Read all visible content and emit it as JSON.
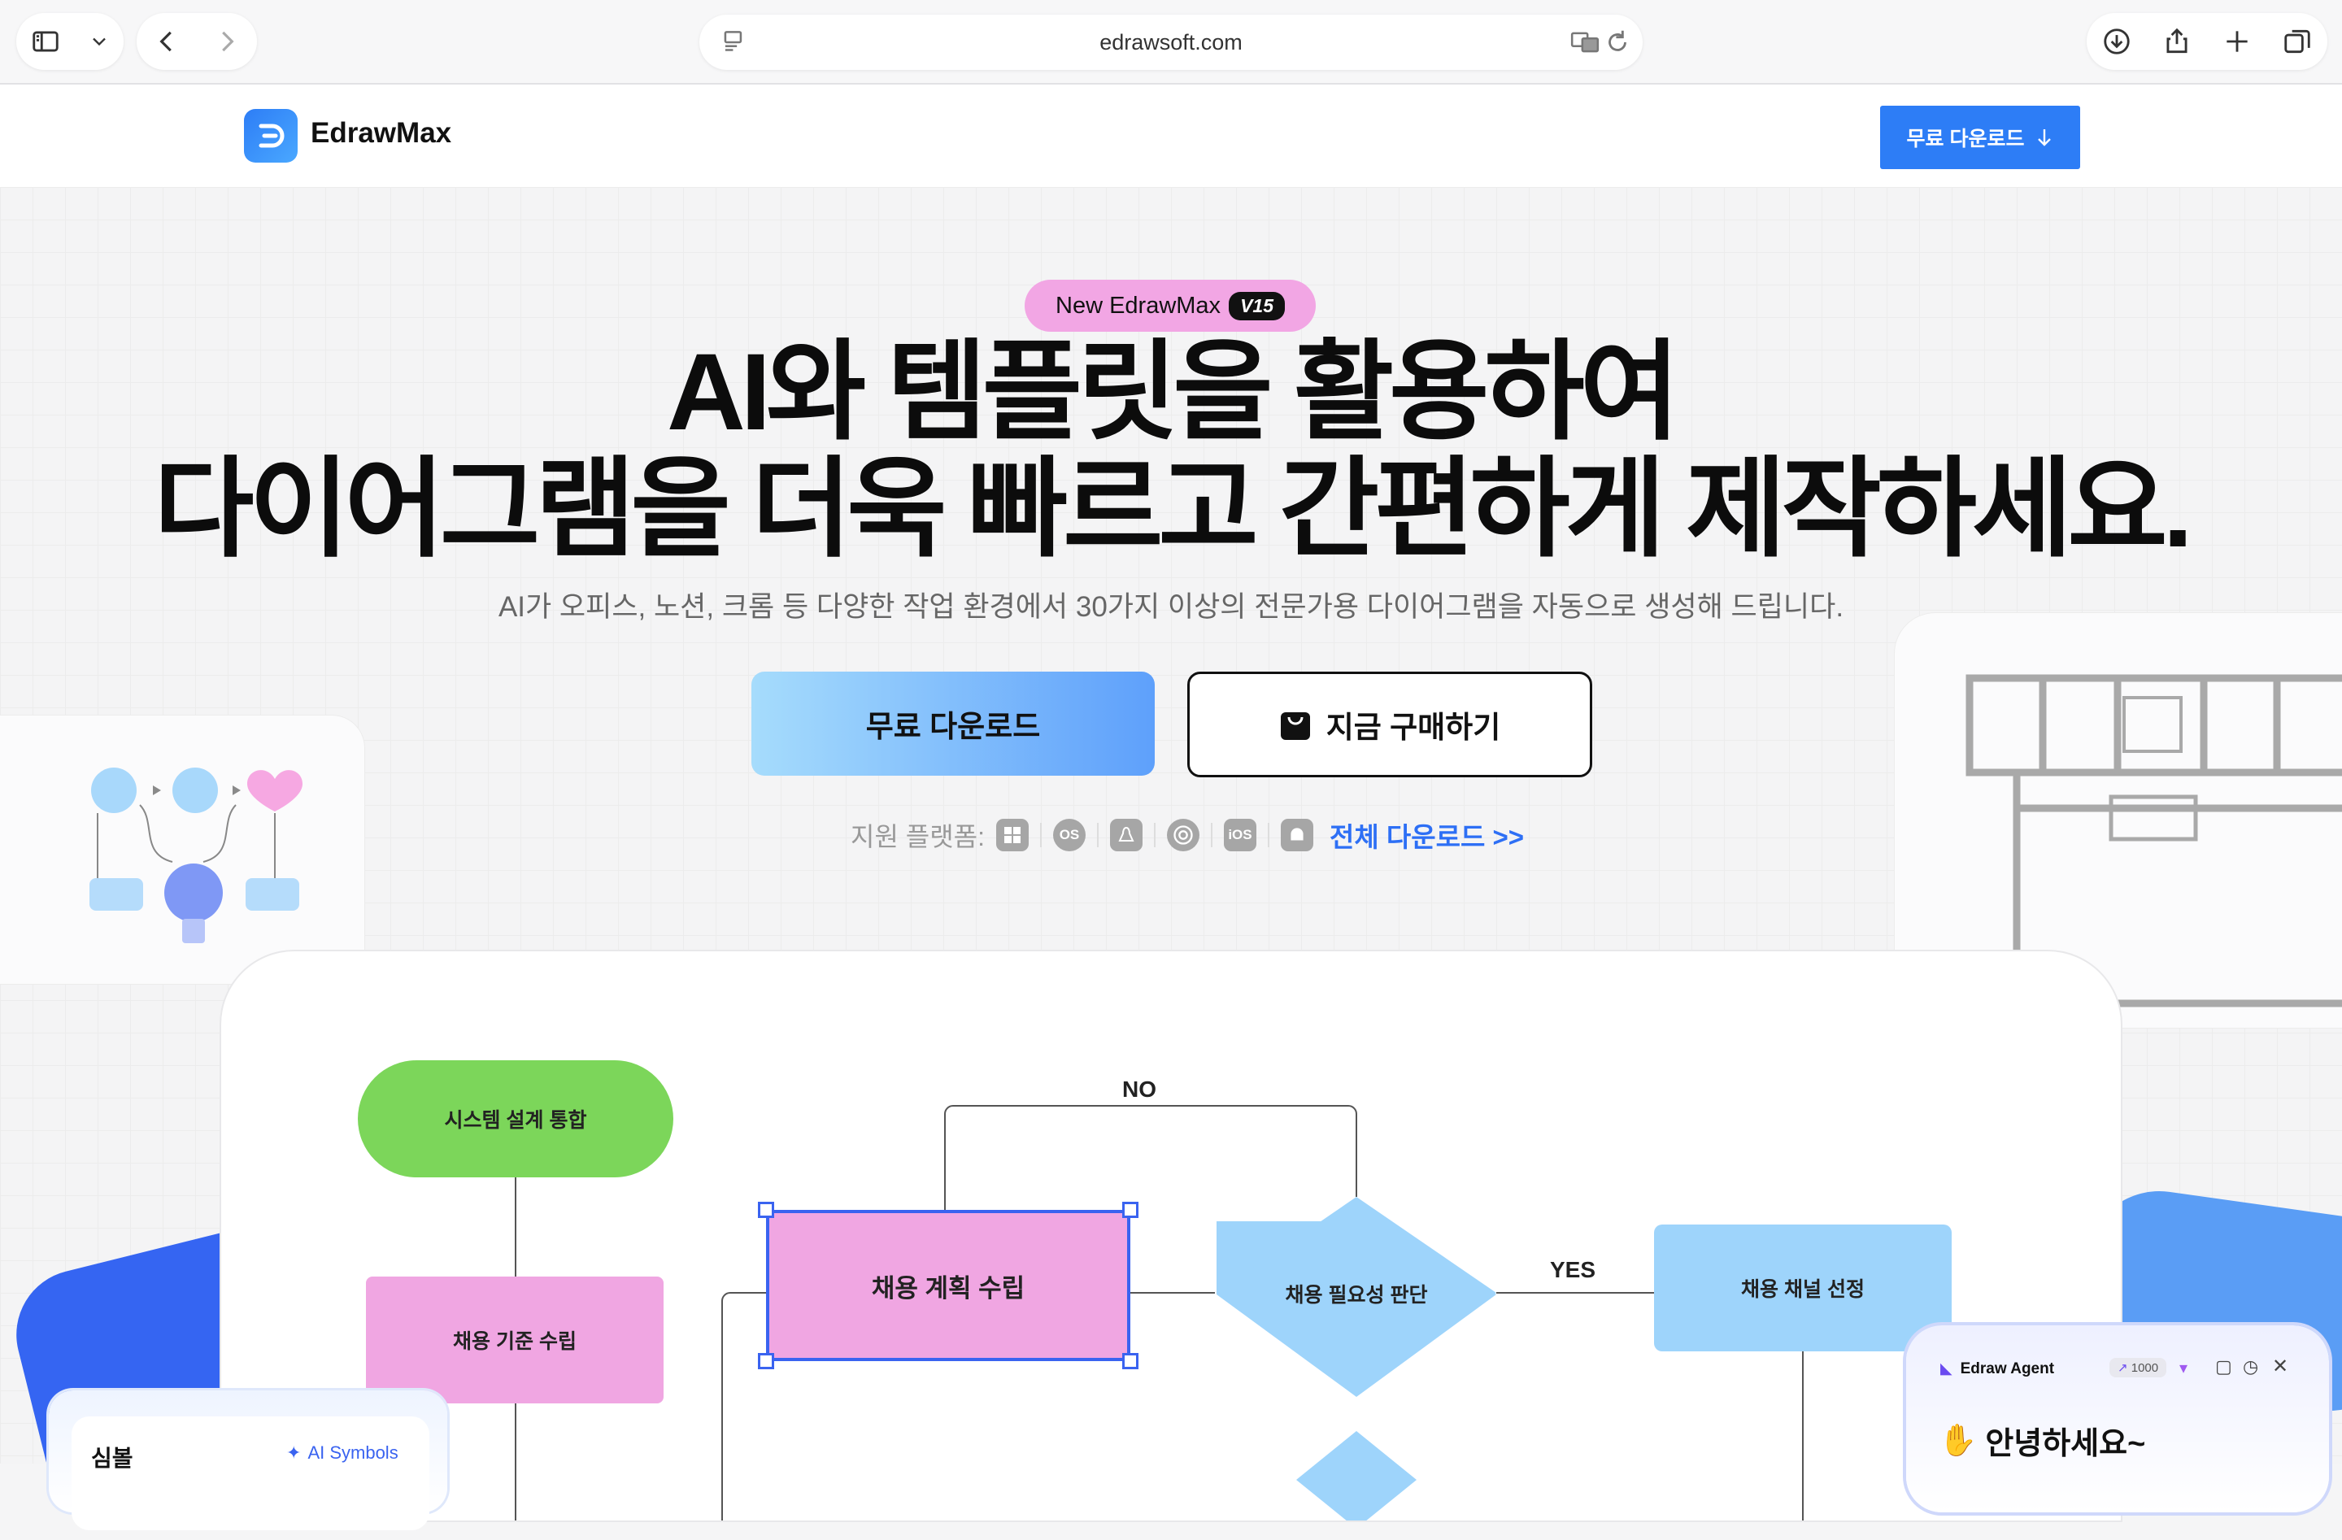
{
  "browser": {
    "url": "edrawsoft.com",
    "icons": [
      "sidebar-icon",
      "chevron-down-icon",
      "back-icon",
      "forward-icon",
      "reader-icon",
      "translate-icon",
      "reload-icon",
      "download-icon",
      "share-icon",
      "new-tab-icon",
      "tabs-overview-icon"
    ]
  },
  "header": {
    "logo_text": "EdrawMax",
    "download_button": "무료 다운로드"
  },
  "hero": {
    "badge_text": "New EdrawMax",
    "badge_version": "V15",
    "headline_line1": "AI와 템플릿을 활용하여",
    "headline_line2": "다이어그램을 더욱 빠르고 간편하게 제작하세요.",
    "subtitle": "AI가 오피스, 노션, 크롬 등 다양한 작업 환경에서 30가지 이상의 전문가용 다이어그램을 자동으로 생성해 드립니다.",
    "primary_cta": "무료 다운로드",
    "secondary_cta": "지금 구매하기",
    "platforms_label": "지원 플랫폼:",
    "platform_icons": [
      "windows-icon",
      "macos-icon",
      "linux-icon",
      "chrome-icon",
      "ios-icon",
      "android-icon"
    ],
    "platform_glyphs": {
      "mac": "OS",
      "ios": "iOS"
    },
    "all_downloads": "전체 다운로드 >>"
  },
  "flowchart": {
    "nodes": {
      "system_design": "시스템 설계 통합",
      "hiring_criteria": "채용 기준 수립",
      "hiring_plan": "채용 계획 수립",
      "hiring_need": "채용 필요성 판단",
      "hiring_channel": "채용 채널 선정"
    },
    "label_no": "NO",
    "label_yes": "YES"
  },
  "symbols_panel": {
    "title": "심볼",
    "ai_link": "AI Symbols"
  },
  "agent_panel": {
    "title": "Edraw Agent",
    "credits": "1000",
    "greeting": "안녕하세요~"
  },
  "colors": {
    "brand_blue": "#2d7df6",
    "badge_pink": "#f2a6e4",
    "node_green": "#7cd65a",
    "node_pink": "#f0a6e2",
    "node_blue": "#9ed4fb",
    "selection": "#3a63f0"
  }
}
